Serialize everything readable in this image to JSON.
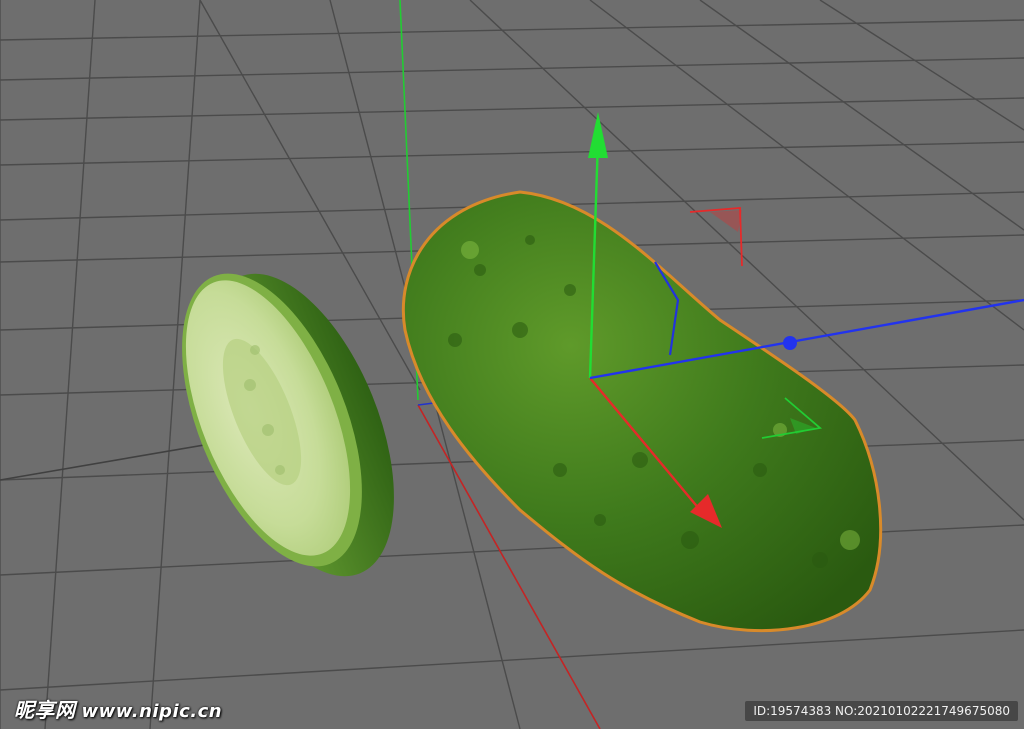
{
  "scene": {
    "background": "#6e6e6e",
    "grid_color": "#4a4a4a",
    "objects": [
      {
        "name": "cucumber",
        "selected": true
      },
      {
        "name": "cucumber-slice",
        "selected": false
      }
    ],
    "axis_colors": {
      "x": "#e62a2a",
      "y": "#22dd33",
      "z": "#2233ee"
    },
    "selection_outline_color": "#d88a2a"
  },
  "watermark": {
    "brand": "昵享网",
    "site": "www.nipic.cn"
  },
  "image_id": "ID:19574383 NO:20210102221749675080"
}
